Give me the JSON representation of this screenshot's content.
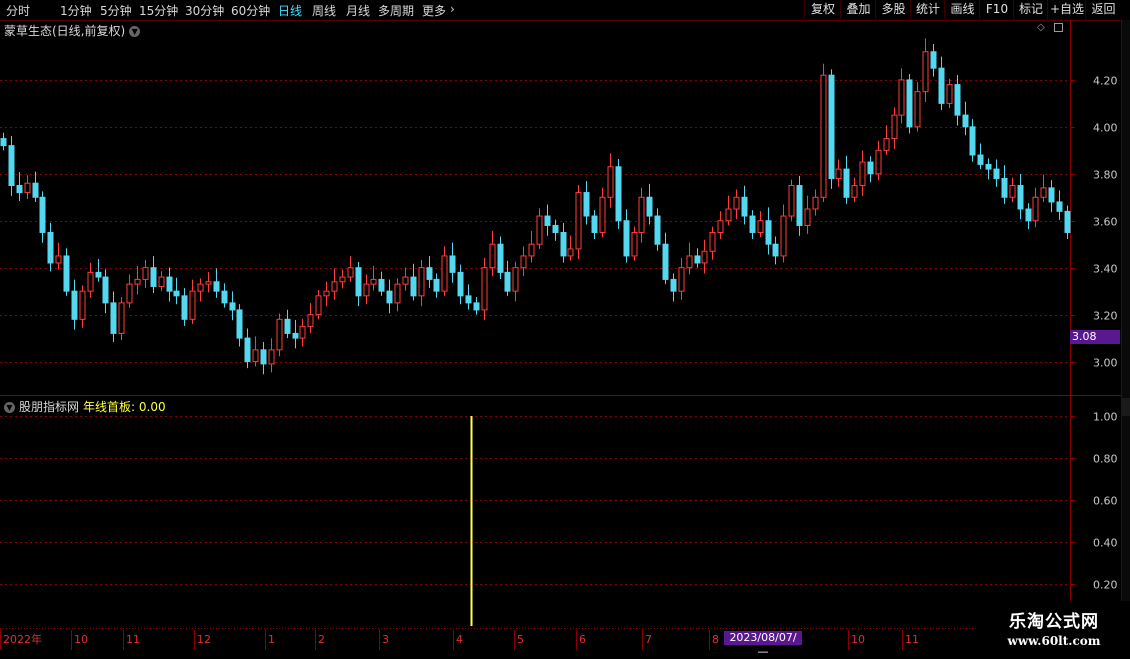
{
  "toolbar": {
    "periods": [
      "分时",
      "1分钟",
      "5分钟",
      "15分钟",
      "30分钟",
      "60分钟",
      "日线",
      "周线",
      "月线",
      "多周期",
      "更多"
    ],
    "active_period": "日线",
    "right_buttons": [
      "复权",
      "叠加",
      "多股",
      "统计",
      "画线",
      "F10",
      "标记",
      "+自选",
      "返回"
    ]
  },
  "main_chart": {
    "title": "蒙草生态(日线,前复权)",
    "current_price": "3.08",
    "y_ticks": [
      "4.20",
      "4.00",
      "3.80",
      "3.60",
      "3.40",
      "3.20",
      "3.00"
    ]
  },
  "indicator": {
    "name": "股朋指标网",
    "label": "年线首板:",
    "value": "0.00",
    "y_ticks": [
      "1.00",
      "0.80",
      "0.60",
      "0.40",
      "0.20"
    ]
  },
  "x_axis": {
    "labels": [
      "2022年",
      "10",
      "11",
      "12",
      "1",
      "2",
      "3",
      "4",
      "5",
      "6",
      "7",
      "8",
      "10",
      "11"
    ],
    "cursor_date": "2023/08/07/—"
  },
  "watermark": {
    "line1": "乐淘公式网",
    "line2": "www.60lt.com"
  },
  "colors": {
    "up": "#ff3c3c",
    "down": "#54d8f0",
    "grid": "#8a0000",
    "signal": "#ffff40",
    "axis_text": "#c8c8c8"
  },
  "chart_data": {
    "type": "candlestick",
    "title": "蒙草生态(日线,前复权)",
    "ylim": [
      2.93,
      4.37
    ],
    "up_color": "#ff3c3c",
    "down_color": "#54d8f0",
    "close_path": [
      3.92,
      3.75,
      3.72,
      3.76,
      3.7,
      3.55,
      3.42,
      3.45,
      3.3,
      3.18,
      3.3,
      3.38,
      3.36,
      3.25,
      3.12,
      3.25,
      3.33,
      3.35,
      3.4,
      3.32,
      3.36,
      3.3,
      3.28,
      3.18,
      3.3,
      3.33,
      3.34,
      3.3,
      3.25,
      3.22,
      3.1,
      3.0,
      3.05,
      2.99,
      3.05,
      3.18,
      3.12,
      3.1,
      3.15,
      3.2,
      3.28,
      3.3,
      3.34,
      3.36,
      3.4,
      3.28,
      3.33,
      3.35,
      3.3,
      3.25,
      3.33,
      3.36,
      3.28,
      3.4,
      3.35,
      3.3,
      3.45,
      3.38,
      3.28,
      3.25,
      3.22,
      3.4,
      3.5,
      3.38,
      3.3,
      3.4,
      3.45,
      3.5,
      3.62,
      3.58,
      3.55,
      3.45,
      3.48,
      3.72,
      3.62,
      3.55,
      3.7,
      3.83,
      3.6,
      3.45,
      3.55,
      3.7,
      3.62,
      3.5,
      3.35,
      3.3,
      3.4,
      3.45,
      3.42,
      3.47,
      3.55,
      3.6,
      3.65,
      3.7,
      3.62,
      3.55,
      3.6,
      3.5,
      3.45,
      3.62,
      3.75,
      3.58,
      3.65,
      3.7,
      4.22,
      3.78,
      3.82,
      3.7,
      3.75,
      3.85,
      3.8,
      3.9,
      3.95,
      4.05,
      4.2,
      4.0,
      4.15,
      4.32,
      4.25,
      4.1,
      4.18,
      4.05,
      4.0,
      3.88,
      3.84,
      3.82,
      3.78,
      3.7,
      3.75,
      3.65,
      3.6,
      3.7,
      3.74,
      3.68,
      3.64,
      3.55
    ]
  },
  "indicator_data": {
    "type": "bar",
    "ylim": [
      0,
      1.0
    ],
    "signal_x_label": "4",
    "signal_value": 1.0
  }
}
